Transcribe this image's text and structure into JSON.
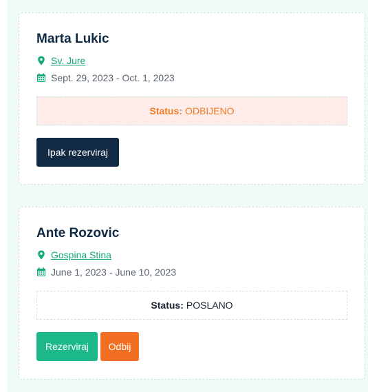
{
  "reservations": [
    {
      "name": "Marta Lukic",
      "location": "Sv. Jure",
      "dates": "Sept. 29, 2023 - Oct. 1, 2023",
      "status_label": "Status:",
      "status_value": "ODBIJENO",
      "actions": [
        "Ipak rezerviraj"
      ]
    },
    {
      "name": "Ante Rozovic",
      "location": "Gospina Stina",
      "dates": "June 1, 2023 - June 10, 2023",
      "status_label": "Status:",
      "status_value": "POSLANO",
      "actions": [
        "Rezerviraj",
        "Odbij"
      ]
    }
  ],
  "icons": {
    "location": "map-pin-icon",
    "calendar": "calendar-icon"
  },
  "colors": {
    "heading": "#0f2a44",
    "link": "#14a87a",
    "declined_bg": "#fdecea",
    "declined_text": "#f07b23",
    "btn_dark": "#122a44",
    "btn_green": "#1db88a",
    "btn_orange": "#f26e22",
    "panel_bg": "#f0fbf6"
  }
}
